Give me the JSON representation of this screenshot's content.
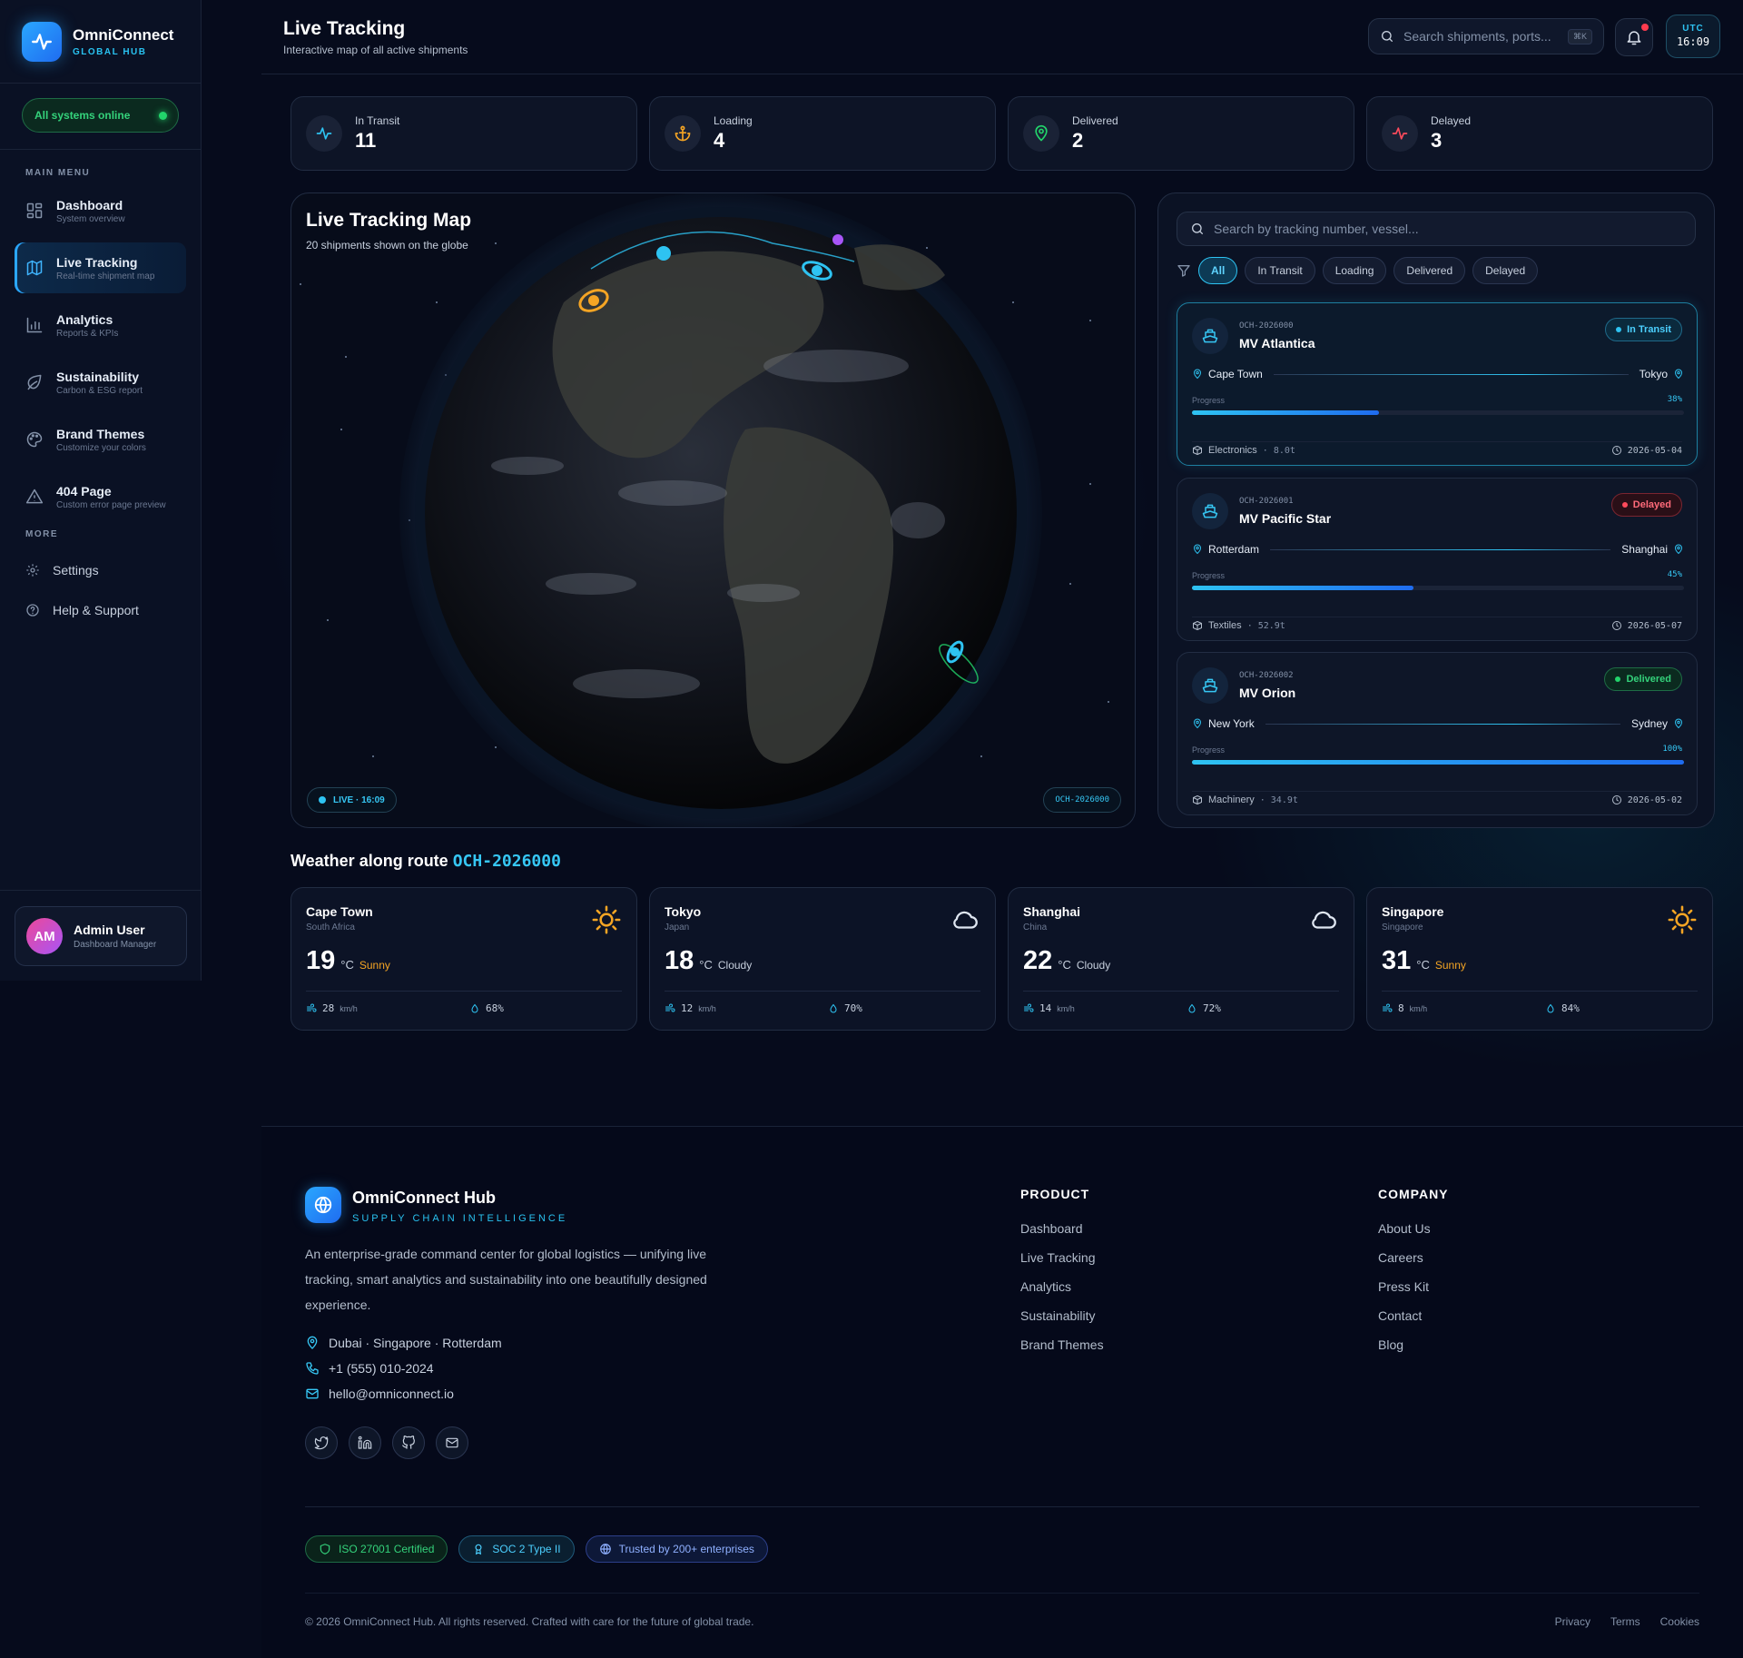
{
  "brand": {
    "name": "OmniConnect",
    "sub": "GLOBAL HUB"
  },
  "system_status": "All systems online",
  "sidebar": {
    "main_heading": "MAIN MENU",
    "items": [
      {
        "label": "Dashboard",
        "sub": "System overview",
        "icon": "grid-icon"
      },
      {
        "label": "Live Tracking",
        "sub": "Real-time shipment map",
        "icon": "map-icon",
        "active": true
      },
      {
        "label": "Analytics",
        "sub": "Reports & KPIs",
        "icon": "bar-chart-icon"
      },
      {
        "label": "Sustainability",
        "sub": "Carbon & ESG report",
        "icon": "leaf-icon"
      },
      {
        "label": "Brand Themes",
        "sub": "Customize your colors",
        "icon": "palette-icon"
      },
      {
        "label": "404 Page",
        "sub": "Custom error page preview",
        "icon": "warning-icon"
      }
    ],
    "more_heading": "MORE",
    "more_items": [
      {
        "label": "Settings",
        "icon": "gear-icon"
      },
      {
        "label": "Help & Support",
        "icon": "help-icon"
      }
    ]
  },
  "user": {
    "initials": "AM",
    "name": "Admin User",
    "role": "Dashboard Manager"
  },
  "header": {
    "title": "Live Tracking",
    "subtitle": "Interactive map of all active shipments",
    "search_placeholder": "Search shipments, ports...",
    "shortcut": "⌘K",
    "utc_label": "UTC",
    "utc_time": "16:09"
  },
  "stats": [
    {
      "label": "In Transit",
      "value": "11",
      "color": "#2ec3f2"
    },
    {
      "label": "Loading",
      "value": "4",
      "color": "#f5a524"
    },
    {
      "label": "Delivered",
      "value": "2",
      "color": "#22d46b"
    },
    {
      "label": "Delayed",
      "value": "3",
      "color": "#ff4b5c"
    }
  ],
  "map": {
    "title": "Live Tracking Map",
    "subtitle": "20 shipments shown on the globe",
    "live_badge": "LIVE · 16:09",
    "selected_code": "OCH-2026000"
  },
  "shipments": {
    "search_placeholder": "Search by tracking number, vessel...",
    "filters": [
      "All",
      "In Transit",
      "Loading",
      "Delivered",
      "Delayed"
    ],
    "active_filter": "All",
    "progress_label": "Progress",
    "items": [
      {
        "code": "OCH-2026000",
        "vessel": "MV Atlantica",
        "status": "In Transit",
        "origin": "Cape Town",
        "destination": "Tokyo",
        "progress_text": "38%",
        "progress": 0.38,
        "cargo": "Electronics",
        "weight": "8.0t",
        "eta": "2026-05-04"
      },
      {
        "code": "OCH-2026001",
        "vessel": "MV Pacific Star",
        "status": "Delayed",
        "origin": "Rotterdam",
        "destination": "Shanghai",
        "progress_text": "45%",
        "progress": 0.45,
        "cargo": "Textiles",
        "weight": "52.9t",
        "eta": "2026-05-07"
      },
      {
        "code": "OCH-2026002",
        "vessel": "MV Orion",
        "status": "Delivered",
        "origin": "New York",
        "destination": "Sydney",
        "progress_text": "100%",
        "progress": 1.0,
        "cargo": "Machinery",
        "weight": "34.9t",
        "eta": "2026-05-02"
      }
    ]
  },
  "weather": {
    "heading": "Weather along route",
    "code": "OCH-2026000",
    "unit": "°C",
    "wind_unit": "km/h",
    "cards": [
      {
        "city": "Cape Town",
        "country": "South Africa",
        "temp": "19",
        "condition": "Sunny",
        "wind": "28",
        "humidity": "68%",
        "icon": "sun-icon"
      },
      {
        "city": "Tokyo",
        "country": "Japan",
        "temp": "18",
        "condition": "Cloudy",
        "wind": "12",
        "humidity": "70%",
        "icon": "cloud-icon"
      },
      {
        "city": "Shanghai",
        "country": "China",
        "temp": "22",
        "condition": "Cloudy",
        "wind": "14",
        "humidity": "72%",
        "icon": "cloud-icon"
      },
      {
        "city": "Singapore",
        "country": "Singapore",
        "temp": "31",
        "condition": "Sunny",
        "wind": "8",
        "humidity": "84%",
        "icon": "sun-icon"
      }
    ]
  },
  "footer": {
    "name": "OmniConnect Hub",
    "tagline": "SUPPLY CHAIN INTELLIGENCE",
    "description": "An enterprise-grade command center for global logistics — unifying live tracking, smart analytics and sustainability into one beautifully designed experience.",
    "location": "Dubai · Singapore · Rotterdam",
    "phone": "+1 (555) 010-2024",
    "email": "hello@omniconnect.io",
    "product_heading": "PRODUCT",
    "product_links": [
      "Dashboard",
      "Live Tracking",
      "Analytics",
      "Sustainability",
      "Brand Themes"
    ],
    "company_heading": "COMPANY",
    "company_links": [
      "About Us",
      "Careers",
      "Press Kit",
      "Contact",
      "Blog"
    ],
    "badges": [
      "ISO 27001 Certified",
      "SOC 2 Type II",
      "Trusted by 200+ enterprises"
    ],
    "copyright": "© 2026 OmniConnect Hub. All rights reserved. Crafted with care for the future of global trade.",
    "legal": [
      "Privacy",
      "Terms",
      "Cookies"
    ]
  }
}
